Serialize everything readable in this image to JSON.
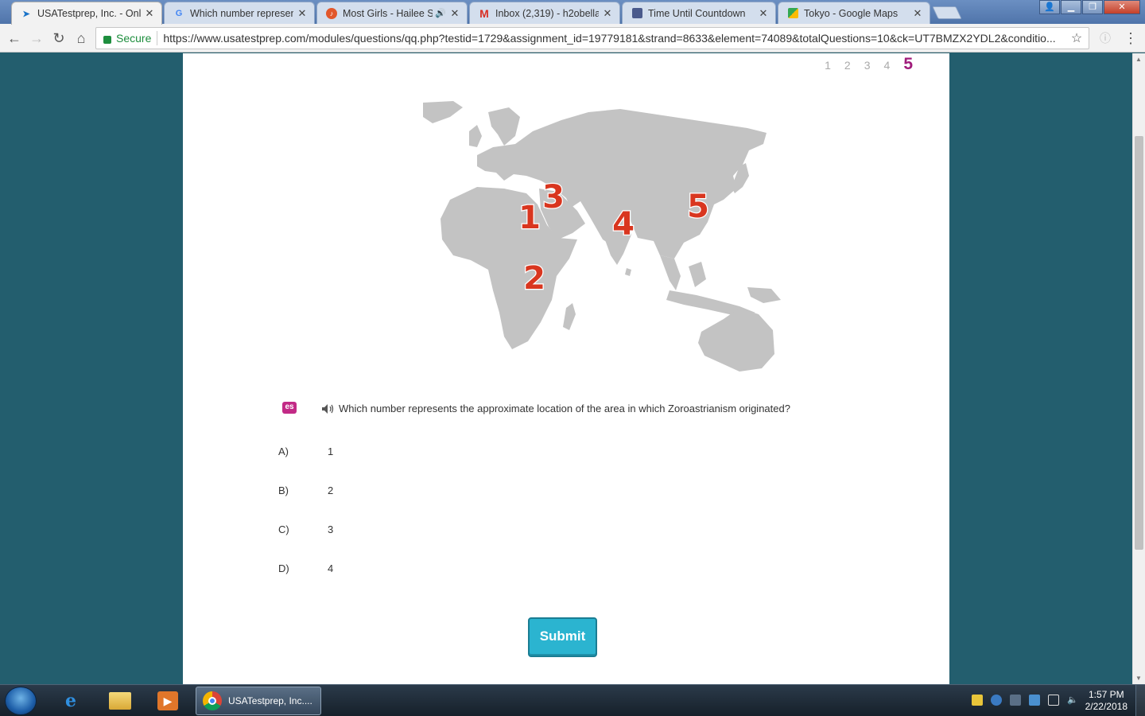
{
  "browser": {
    "tabs": [
      {
        "label": "USATestprep, Inc. - Onlin",
        "icon": "cursor-icon",
        "active": true
      },
      {
        "label": "Which number represent",
        "icon": "google-icon",
        "active": false
      },
      {
        "label": "Most Girls - Hailee St",
        "icon": "music-icon",
        "active": false,
        "audio": true
      },
      {
        "label": "Inbox (2,319) - h2obella6",
        "icon": "gmail-icon",
        "active": false
      },
      {
        "label": "Time Until Countdown",
        "icon": "countdown-icon",
        "active": false
      },
      {
        "label": "Tokyo - Google Maps",
        "icon": "maps-icon",
        "active": false
      }
    ],
    "tab_close_glyph": "✕",
    "secure_label": "Secure",
    "url": "https://www.usatestprep.com/modules/questions/qq.php?testid=1729&assignment_id=19779181&strand=8633&element=74089&totalQuestions=10&ck=UT7BMZX2YDL2&conditio..."
  },
  "page": {
    "question_numbers": [
      "1",
      "2",
      "3",
      "4",
      "5"
    ],
    "current_question": "5",
    "map": {
      "markers": [
        "1",
        "2",
        "3",
        "4",
        "5"
      ],
      "colors": {
        "land": "#c3c3c3",
        "marker_fill": "#d9361f",
        "marker_stroke": "#ffffff"
      }
    },
    "spanish_icon_label": "es",
    "question_text": "Which number represents the approximate location of the area in which Zoroastrianism originated?",
    "answers": [
      {
        "letter": "A)",
        "value": "1"
      },
      {
        "letter": "B)",
        "value": "2"
      },
      {
        "letter": "C)",
        "value": "3"
      },
      {
        "letter": "D)",
        "value": "4"
      }
    ],
    "submit_label": "Submit",
    "colors": {
      "background": "#235e6e",
      "accent": "#a01c7b",
      "submit": "#2bb4d0"
    }
  },
  "taskbar": {
    "active_task_label": "USATestprep, Inc....",
    "clock_time": "1:57 PM",
    "clock_date": "2/22/2018"
  }
}
